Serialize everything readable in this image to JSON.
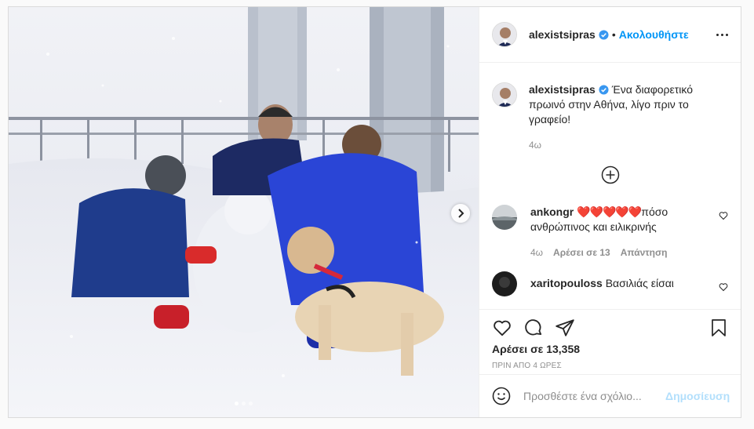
{
  "post": {
    "images_count": 3,
    "active_image": 1,
    "next_icon": "chevron-right-icon"
  },
  "header": {
    "username": "alexistsipras",
    "verified_icon": "verified-badge-icon",
    "separator": "•",
    "follow_label": "Ακολουθήστε",
    "more_icon": "more-options-icon"
  },
  "caption": {
    "username": "alexistsipras",
    "text": "Ένα διαφορετικό πρωινό στην Αθήνα, λίγο πριν το γραφείο!",
    "time": "4ω"
  },
  "load_more_icon": "plus-circle-icon",
  "comments": [
    {
      "username": "ankongr",
      "hearts": "❤️❤️❤️❤️❤️",
      "text": "πόσο ανθρώπινος και ειλικρινής",
      "time": "4ω",
      "likes": "Αρέσει σε 13",
      "reply": "Απάντηση"
    },
    {
      "username": "xaritopouloss",
      "text": "Βασιλιάς είσαι"
    }
  ],
  "actions": {
    "like_icon": "heart-icon",
    "comment_icon": "comment-icon",
    "share_icon": "send-icon",
    "save_icon": "bookmark-icon",
    "likes_text": "Αρέσει σε 13,358",
    "posted_ago": "ΠΡΙΝ ΑΠΟ 4 ΩΡΕΣ"
  },
  "add_comment": {
    "emoji_icon": "emoji-icon",
    "placeholder": "Προσθέστε ένα σχόλιο...",
    "publish_label": "Δημοσίευση"
  },
  "colors": {
    "accent": "#0095f6",
    "publish_disabled": "#b2dffc",
    "muted": "#8e8e8e",
    "verified": "#3897f0"
  }
}
